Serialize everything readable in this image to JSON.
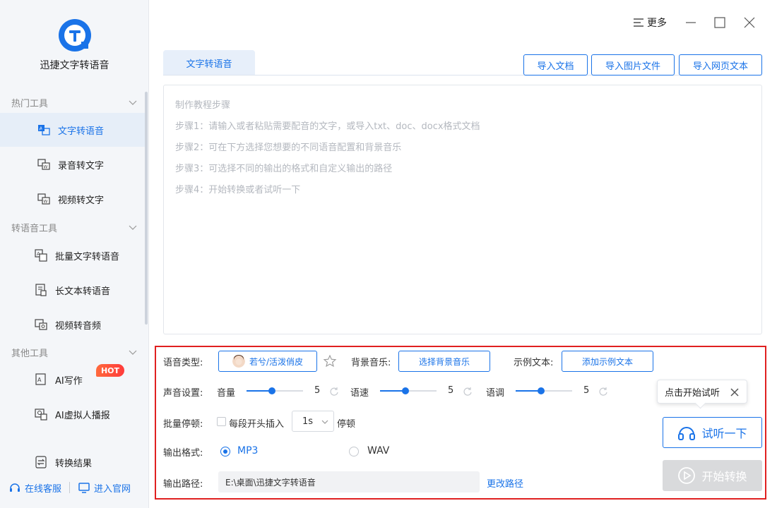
{
  "app": {
    "name": "迅捷文字转语音"
  },
  "titlebar": {
    "more_label": "更多"
  },
  "sidebar": {
    "categories": [
      "热门工具",
      "转语音工具",
      "其他工具"
    ],
    "items": [
      {
        "label": "文字转语音",
        "icon": "text-to-speech-icon",
        "active": true
      },
      {
        "label": "录音转文字",
        "icon": "audio-to-text-icon"
      },
      {
        "label": "视频转文字",
        "icon": "video-to-text-icon"
      },
      {
        "label": "批量文字转语音",
        "icon": "batch-text-to-speech-icon"
      },
      {
        "label": "长文本转语音",
        "icon": "long-text-to-speech-icon"
      },
      {
        "label": "视频转音频",
        "icon": "video-to-audio-icon"
      },
      {
        "label": "AI写作",
        "icon": "ai-writing-icon",
        "badge": "HOT"
      },
      {
        "label": "AI虚拟人播报",
        "icon": "ai-avatar-icon"
      },
      {
        "label": "转换结果",
        "icon": "results-icon"
      }
    ],
    "online_service": "在线客服",
    "official_site": "进入官网"
  },
  "tabs": {
    "active": "文字转语音"
  },
  "import_buttons": [
    "导入文档",
    "导入图片文件",
    "导入网页文本"
  ],
  "editor": {
    "placeholder_lines": [
      "制作教程步骤",
      "步骤1：请输入或者粘贴需要配音的文字，或导入txt、doc、docx格式文档",
      "步骤2：可在下方选择您想要的不同语音配置和背景音乐",
      "步骤3：可选择不同的输出的格式和自定义输出的路径",
      "步骤4：开始转换或者试听一下"
    ]
  },
  "settings": {
    "voice_type_label": "语音类型:",
    "voice_value": "若兮/活泼俏皮",
    "bg_music_label": "背景音乐:",
    "bg_music_button": "选择背景音乐",
    "sample_text_label": "示例文本:",
    "sample_text_button": "添加示例文本",
    "sound_label": "声音设置:",
    "volume_label": "音量",
    "volume_value": "5",
    "speed_label": "语速",
    "speed_value": "5",
    "pitch_label": "语调",
    "pitch_value": "5",
    "slider_level": 0.45,
    "batch_pause_label": "批量停顿:",
    "insert_label": "每段开头插入",
    "pause_value": "1s",
    "pause_suffix": "停顿",
    "format_label": "输出格式:",
    "format_mp3": "MP3",
    "format_wav": "WAV",
    "selected_format": "MP3",
    "output_path_label": "输出路径:",
    "output_path_value": "E:\\桌面\\迅捷文字转语音",
    "change_path": "更改路径"
  },
  "tooltip": {
    "text": "点击开始试听"
  },
  "actions": {
    "preview": "试听一下",
    "start": "开始转换"
  },
  "colors": {
    "accent": "#1a73e8",
    "highlight_border": "#e02020",
    "hot": "#ff4a3a",
    "disabled": "#d9dadc"
  }
}
